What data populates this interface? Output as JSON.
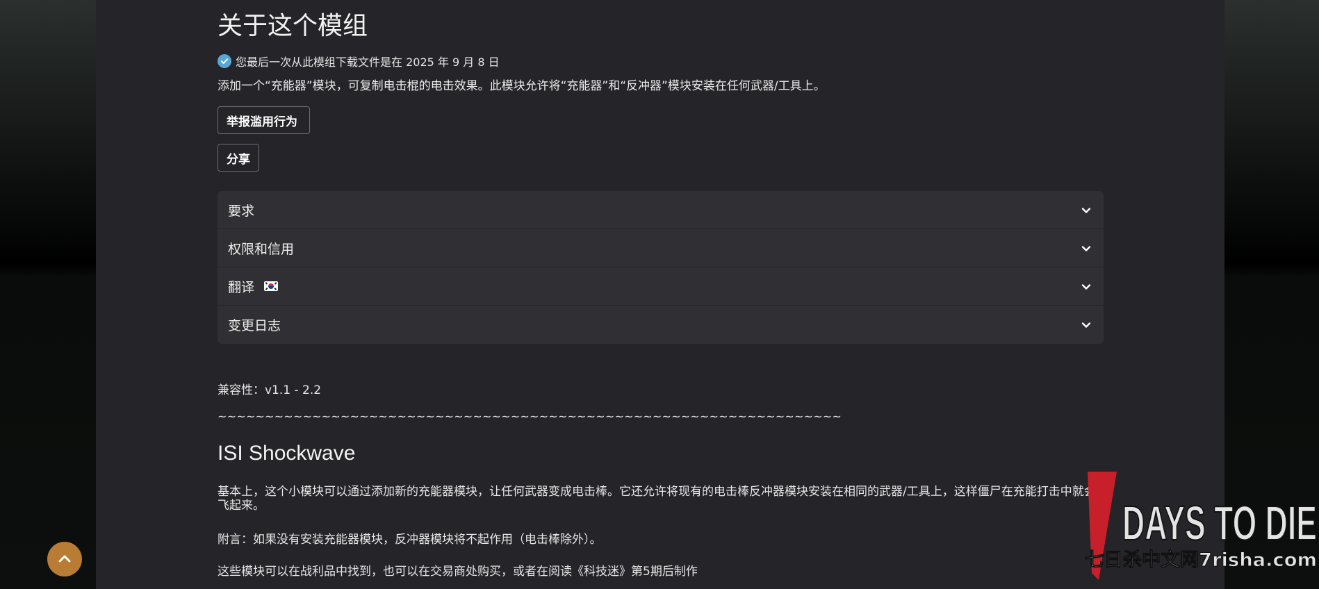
{
  "header": {
    "title": "关于这个模组"
  },
  "download_note": {
    "text": "您最后一次从此模组下载文件是在 2025 年 9 月 8 日"
  },
  "summary": "添加一个“充能器”模块，可复制电击棍的电击效果。此模块允许将“充能器”和“反冲器”模块安装在任何武器/工具上。",
  "buttons": {
    "report_label": "举报滥用行为",
    "share_label": "分享"
  },
  "accordion": {
    "items": [
      {
        "label": "要求"
      },
      {
        "label": "权限和信用"
      },
      {
        "label": "翻译"
      },
      {
        "label": "变更日志"
      }
    ]
  },
  "description": {
    "compatibility": "兼容性：v1.1 - 2.2",
    "separator": "~~~~~~~~~~~~~~~~~~~~~~~~~~~~~~~~~~~~~~~~~~~~~~~~~~~~~~~~~~~~~~~~~~",
    "mod_name": "ISI Shockwave",
    "paragraphs": [
      "基本上，这个小模块可以通过添加新的充能器模块，让任何武器变成电击棒。它还允许将现有的电击棒反冲器模块安装在相同的武器/工具上，这样僵尸在充能打击中就会飞起来。",
      "附言：如果没有安装充能器模块，反冲器模块将不起作用（电击棒除外）。",
      "这些模块可以在战利品中找到，也可以在交易商处购买，或者在阅读《科技迷》第5期后制作"
    ]
  },
  "watermark": {
    "logo_text": "DAYS TO DIE",
    "logo_number": "7",
    "site_text": "七日杀中文网7risha.com"
  },
  "colors": {
    "page_bg": "#252429",
    "accordion_bg": "#303034",
    "check_blue": "#5aa7d6",
    "scroll_btn": "#b87c34",
    "logo_red": "#c8202a"
  },
  "icons": {
    "check": "check-circle-icon",
    "chevron": "chevron-down-icon",
    "flag": "korea-flag-icon",
    "scroll_top": "chevron-up-icon"
  }
}
